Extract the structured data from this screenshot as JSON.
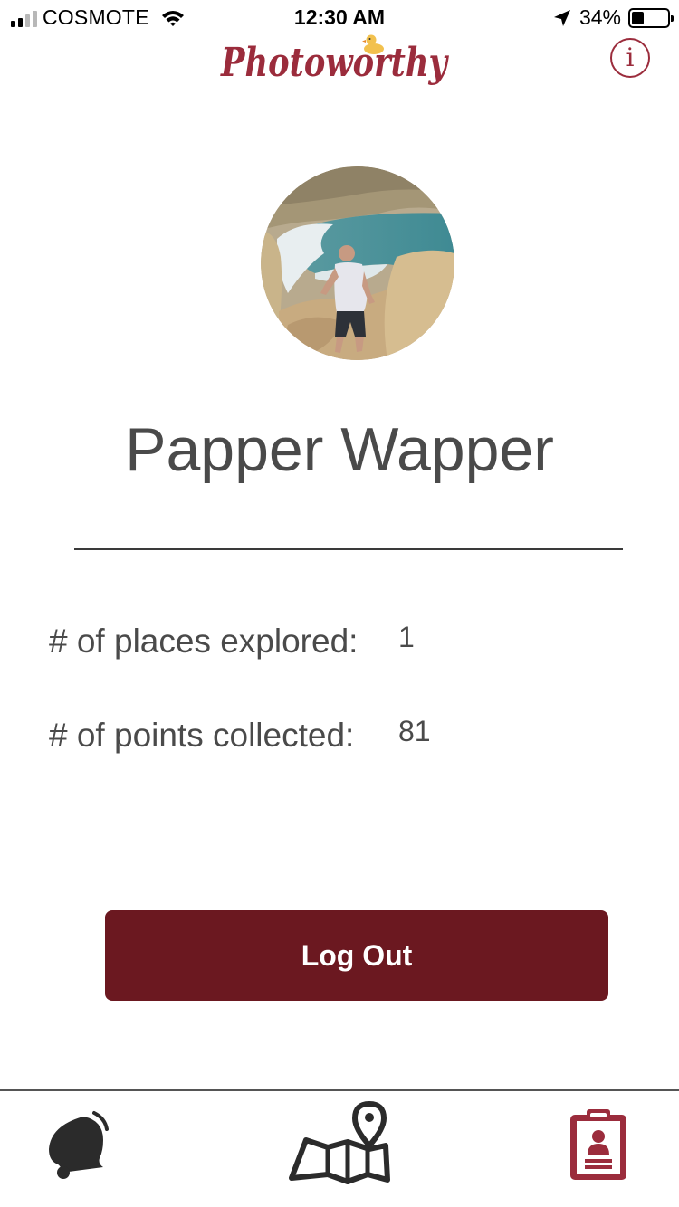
{
  "status_bar": {
    "carrier": "COSMOTE",
    "time": "12:30 AM",
    "battery_percent": "34%",
    "battery_level": 0.34
  },
  "header": {
    "logo_text": "Photoworthy",
    "info_label": "i"
  },
  "profile": {
    "name": "Papper Wapper",
    "stats": [
      {
        "label": "# of places explored:",
        "value": "1"
      },
      {
        "label": "# of points collected:",
        "value": "81"
      }
    ]
  },
  "actions": {
    "logout_label": "Log Out"
  },
  "tab_bar": {
    "tabs": [
      {
        "icon": "bell-icon",
        "active": false
      },
      {
        "icon": "map-pin-icon",
        "active": false
      },
      {
        "icon": "clipboard-profile-icon",
        "active": true
      }
    ]
  },
  "colors": {
    "brand": "#9b2c3c",
    "button": "#6b1820",
    "text": "#4a4a4a",
    "active_tab": "#9b2c3c",
    "inactive_tab": "#2b2b2b"
  }
}
